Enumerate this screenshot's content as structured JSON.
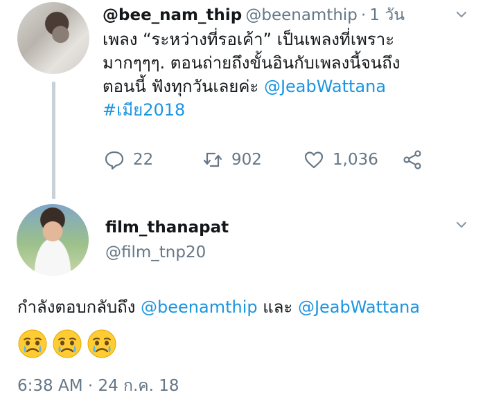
{
  "tweet": {
    "display_name": "@bee_nam_thip",
    "handle": "@beenamthip",
    "time": "1 วัน",
    "text_lines": [
      "เพลง “ระหว่างที่รอเค้า” เป็นเพลงที่เพราะ",
      "มากๆๆๆ. ตอนถ่ายถึงขั้นอินกับเพลงนี้จนถึง",
      "ตอนนี้ ฟังทุกวันเลยค่ะ "
    ],
    "mention": "@JeabWattana",
    "hashtag": "#เมีย2018",
    "actions": {
      "replies": "22",
      "retweets": "902",
      "likes": "1,036"
    }
  },
  "reply": {
    "display_name": "film_thanapat",
    "handle": "@film_tnp20",
    "replying_prefix": "กำลังตอบกลับถึง ",
    "replying_mention_1": "@beenamthip",
    "replying_and": " และ ",
    "replying_mention_2": "@JeabWattana",
    "emojis": [
      "crying-face-emoji",
      "crying-face-emoji",
      "crying-face-emoji"
    ],
    "timestamp": "6:38 AM · 24 ก.ค. 18"
  },
  "colors": {
    "link": "#1b95e0",
    "secondary_text": "#657786",
    "thread_line": "#c8d1d9"
  }
}
